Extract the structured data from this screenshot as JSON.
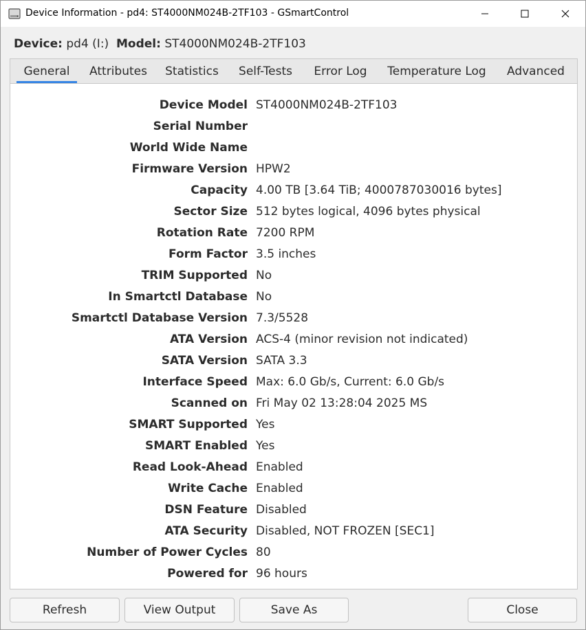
{
  "window": {
    "title": "Device Information - pd4: ST4000NM024B-2TF103 - GSmartControl",
    "app_icon": "hard-drive-icon"
  },
  "header": {
    "device_label": "Device:",
    "device_value": "pd4 (I:)",
    "model_label": "Model:",
    "model_value": "ST4000NM024B-2TF103"
  },
  "tabs": [
    {
      "label": "General",
      "active": true
    },
    {
      "label": "Attributes"
    },
    {
      "label": "Statistics"
    },
    {
      "label": "Self-Tests"
    },
    {
      "label": "Error Log"
    },
    {
      "label": "Temperature Log"
    },
    {
      "label": "Advanced"
    }
  ],
  "info": [
    {
      "label": "Device Model",
      "value": "ST4000NM024B-2TF103"
    },
    {
      "label": "Serial Number",
      "value": ""
    },
    {
      "label": "World Wide Name",
      "value": ""
    },
    {
      "label": "Firmware Version",
      "value": "HPW2"
    },
    {
      "label": "Capacity",
      "value": "4.00 TB [3.64 TiB; 4000787030016 bytes]"
    },
    {
      "label": "Sector Size",
      "value": "512 bytes logical, 4096 bytes physical"
    },
    {
      "label": "Rotation Rate",
      "value": "7200 RPM"
    },
    {
      "label": "Form Factor",
      "value": "3.5 inches"
    },
    {
      "label": "TRIM Supported",
      "value": "No"
    },
    {
      "label": "In Smartctl Database",
      "value": "No"
    },
    {
      "label": "Smartctl Database Version",
      "value": "7.3/5528"
    },
    {
      "label": "ATA Version",
      "value": "ACS-4 (minor revision not indicated)"
    },
    {
      "label": "SATA Version",
      "value": "SATA 3.3"
    },
    {
      "label": "Interface Speed",
      "value": "Max: 6.0 Gb/s, Current: 6.0 Gb/s"
    },
    {
      "label": "Scanned on",
      "value": "Fri May 02 13:28:04 2025 MS"
    },
    {
      "label": "SMART Supported",
      "value": "Yes"
    },
    {
      "label": "SMART Enabled",
      "value": "Yes"
    },
    {
      "label": "Read Look-Ahead",
      "value": "Enabled"
    },
    {
      "label": "Write Cache",
      "value": "Enabled"
    },
    {
      "label": "DSN Feature",
      "value": "Disabled"
    },
    {
      "label": "ATA Security",
      "value": "Disabled, NOT FROZEN [SEC1]"
    },
    {
      "label": "Number of Power Cycles",
      "value": "80"
    },
    {
      "label": "Powered for",
      "value": "96 hours"
    }
  ],
  "buttons": {
    "refresh": "Refresh",
    "view_output": "View Output",
    "save_as": "Save As",
    "close": "Close"
  },
  "colors": {
    "tab_accent": "#3584e4",
    "panel_bg": "#ffffff",
    "window_bg": "#f0f0f0"
  }
}
